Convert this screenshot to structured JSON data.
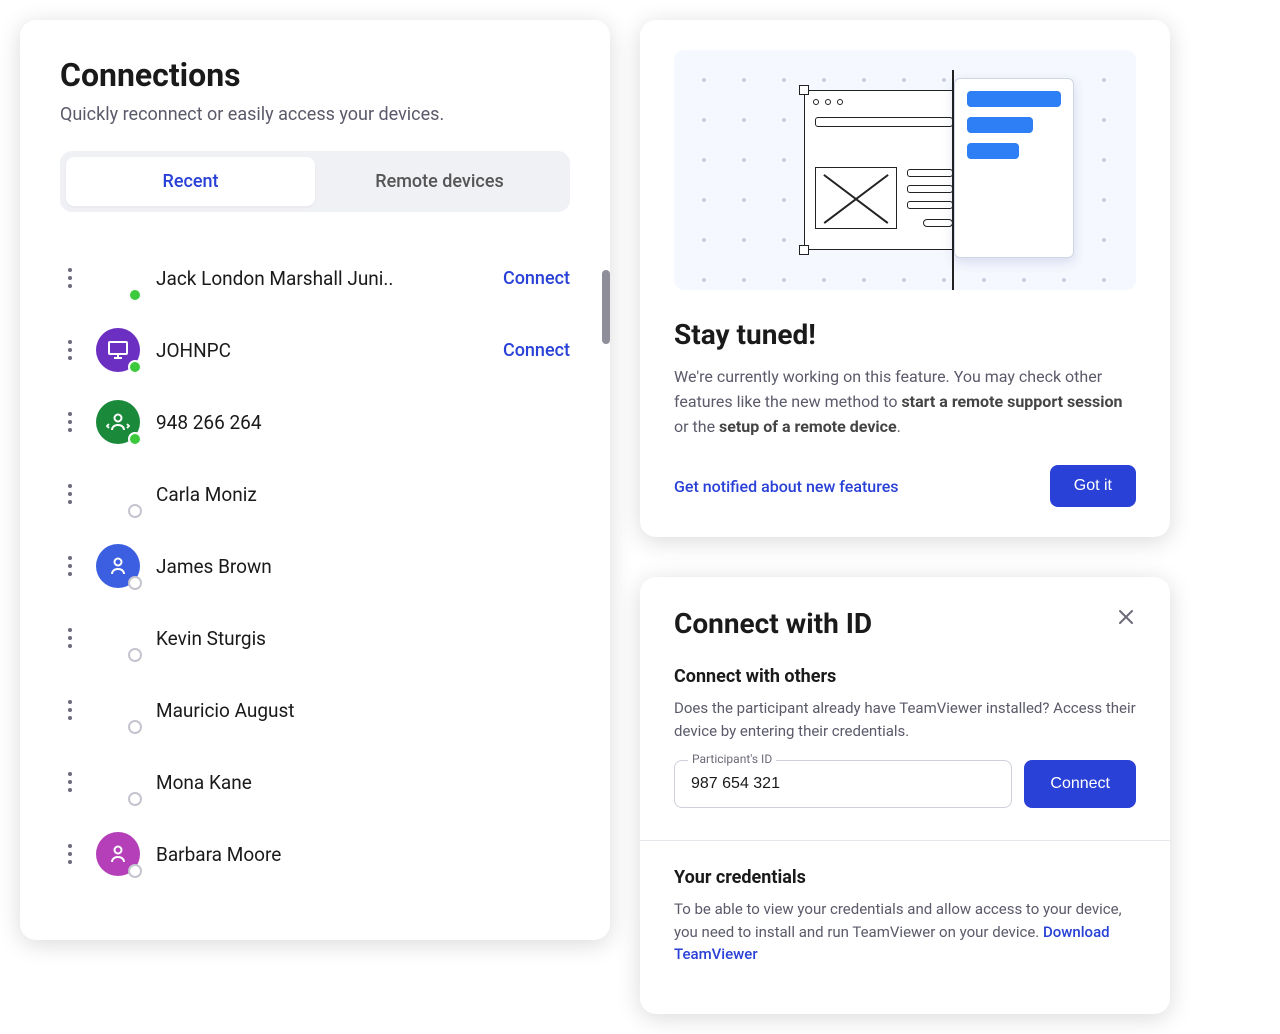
{
  "connections": {
    "title": "Connections",
    "subtitle": "Quickly reconnect or easily access your devices.",
    "tabs": [
      {
        "label": "Recent",
        "active": true
      },
      {
        "label": "Remote devices",
        "active": false
      }
    ],
    "items": [
      {
        "name": "Jack London Marshall Juni..",
        "avatar": "none",
        "status": "online",
        "connect": "Connect"
      },
      {
        "name": "JOHNPC",
        "avatar": "monitor",
        "avatarColor": "#6b2fc1",
        "status": "online",
        "connect": "Connect"
      },
      {
        "name": "948 266 264",
        "avatar": "transfer",
        "avatarColor": "#1a8a3a",
        "status": "online",
        "connect": ""
      },
      {
        "name": "Carla Moniz",
        "avatar": "none",
        "status": "offline",
        "connect": ""
      },
      {
        "name": "James Brown",
        "avatar": "person",
        "avatarColor": "#3b5fe0",
        "status": "offline",
        "connect": ""
      },
      {
        "name": "Kevin Sturgis",
        "avatar": "none",
        "status": "offline",
        "connect": ""
      },
      {
        "name": "Mauricio August",
        "avatar": "none",
        "status": "offline",
        "connect": ""
      },
      {
        "name": "Mona Kane",
        "avatar": "none",
        "status": "offline",
        "connect": ""
      },
      {
        "name": "Barbara Moore",
        "avatar": "person",
        "avatarColor": "#b43fb8",
        "status": "offline",
        "connect": ""
      }
    ]
  },
  "promo": {
    "title": "Stay tuned!",
    "text_pre": "We're currently working on this feature. You may check other features like the new method to ",
    "text_bold1": "start a remote support session",
    "text_mid": " or the ",
    "text_bold2": "setup of a remote device",
    "text_post": ".",
    "notify_link": "Get notified about new features",
    "got_it": "Got it"
  },
  "connect_id": {
    "title": "Connect with ID",
    "section1_heading": "Connect with others",
    "section1_text": "Does the participant already have TeamViewer installed? Access their device by entering their credentials.",
    "input_label": "Participant's ID",
    "input_value": "987 654 321",
    "connect_button": "Connect",
    "section2_heading": "Your credentials",
    "section2_text": "To be able to view your credentials and allow access to your device, you need to install and run TeamViewer on your device.  ",
    "download_link": "Download TeamViewer"
  }
}
